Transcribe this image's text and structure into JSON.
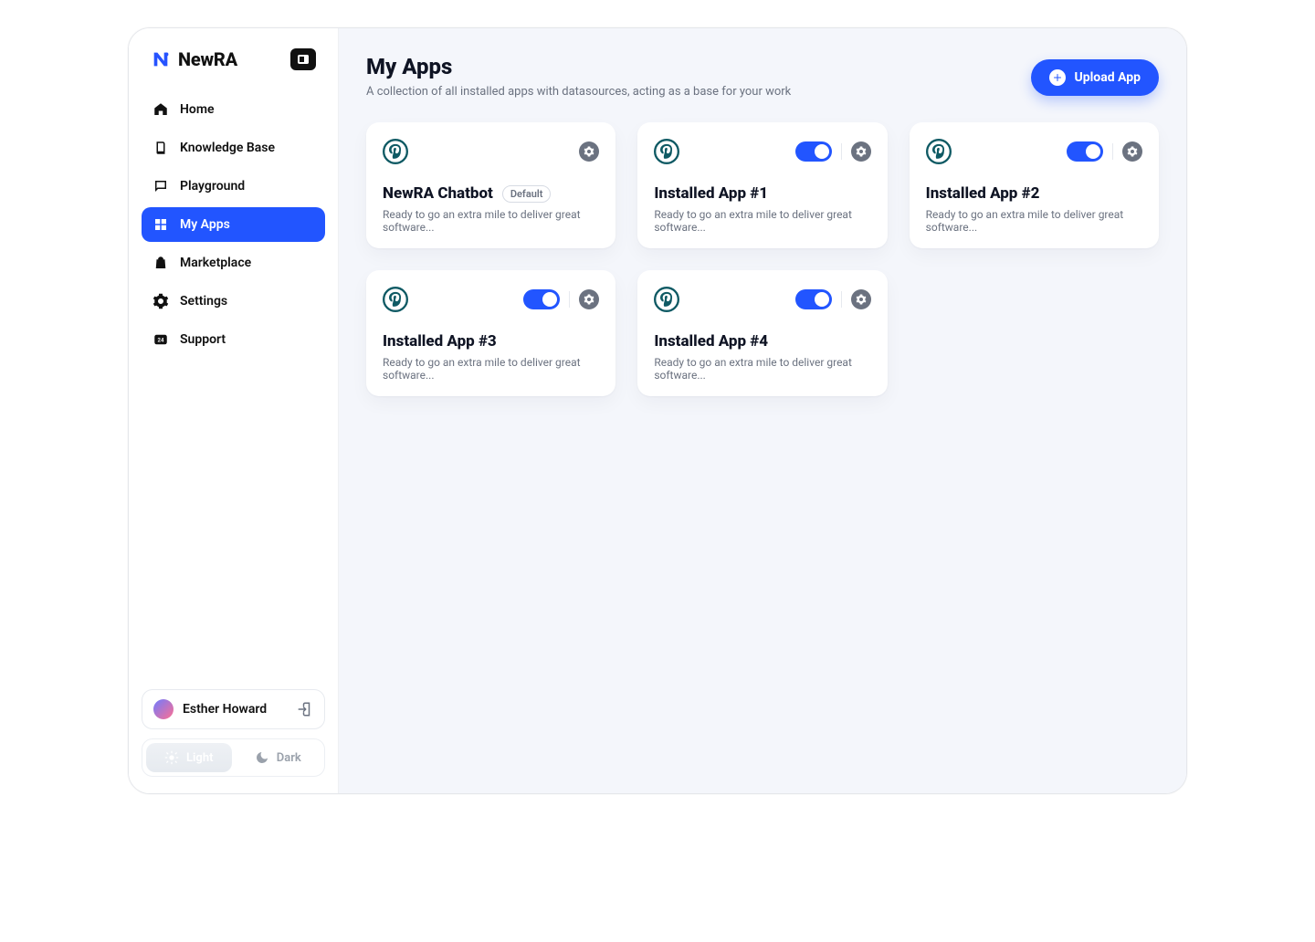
{
  "brand": {
    "name": "NewRA"
  },
  "sidebar": {
    "items": [
      {
        "id": "home",
        "label": "Home",
        "icon": "home-icon"
      },
      {
        "id": "knowledge",
        "label": "Knowledge Base",
        "icon": "book-icon"
      },
      {
        "id": "playground",
        "label": "Playground",
        "icon": "chat-icon"
      },
      {
        "id": "myapps",
        "label": "My Apps",
        "icon": "apps-icon"
      },
      {
        "id": "marketplace",
        "label": "Marketplace",
        "icon": "bag-icon"
      },
      {
        "id": "settings",
        "label": "Settings",
        "icon": "gear-icon"
      },
      {
        "id": "support",
        "label": "Support",
        "icon": "support-icon"
      }
    ],
    "active_id": "myapps"
  },
  "user": {
    "name": "Esther Howard"
  },
  "theme": {
    "light_label": "Light",
    "dark_label": "Dark",
    "active": "light"
  },
  "page": {
    "title": "My Apps",
    "subtitle": "A collection of all installed apps with datasources, acting as a base for your work",
    "upload_button_label": "Upload App"
  },
  "apps": [
    {
      "title": "NewRA Chatbot",
      "desc": "Ready to go an extra mile to deliver great software...",
      "badge": "Default",
      "has_toggle": false
    },
    {
      "title": "Installed App #1",
      "desc": "Ready to go an extra mile to deliver great software...",
      "has_toggle": true
    },
    {
      "title": "Installed App #2",
      "desc": "Ready to go an extra mile to deliver great software...",
      "has_toggle": true
    },
    {
      "title": "Installed App #3",
      "desc": "Ready to go an extra mile to deliver great software...",
      "has_toggle": true
    },
    {
      "title": "Installed App #4",
      "desc": "Ready to go an extra mile to deliver great software...",
      "has_toggle": true
    }
  ],
  "colors": {
    "accent": "#2255ff"
  }
}
